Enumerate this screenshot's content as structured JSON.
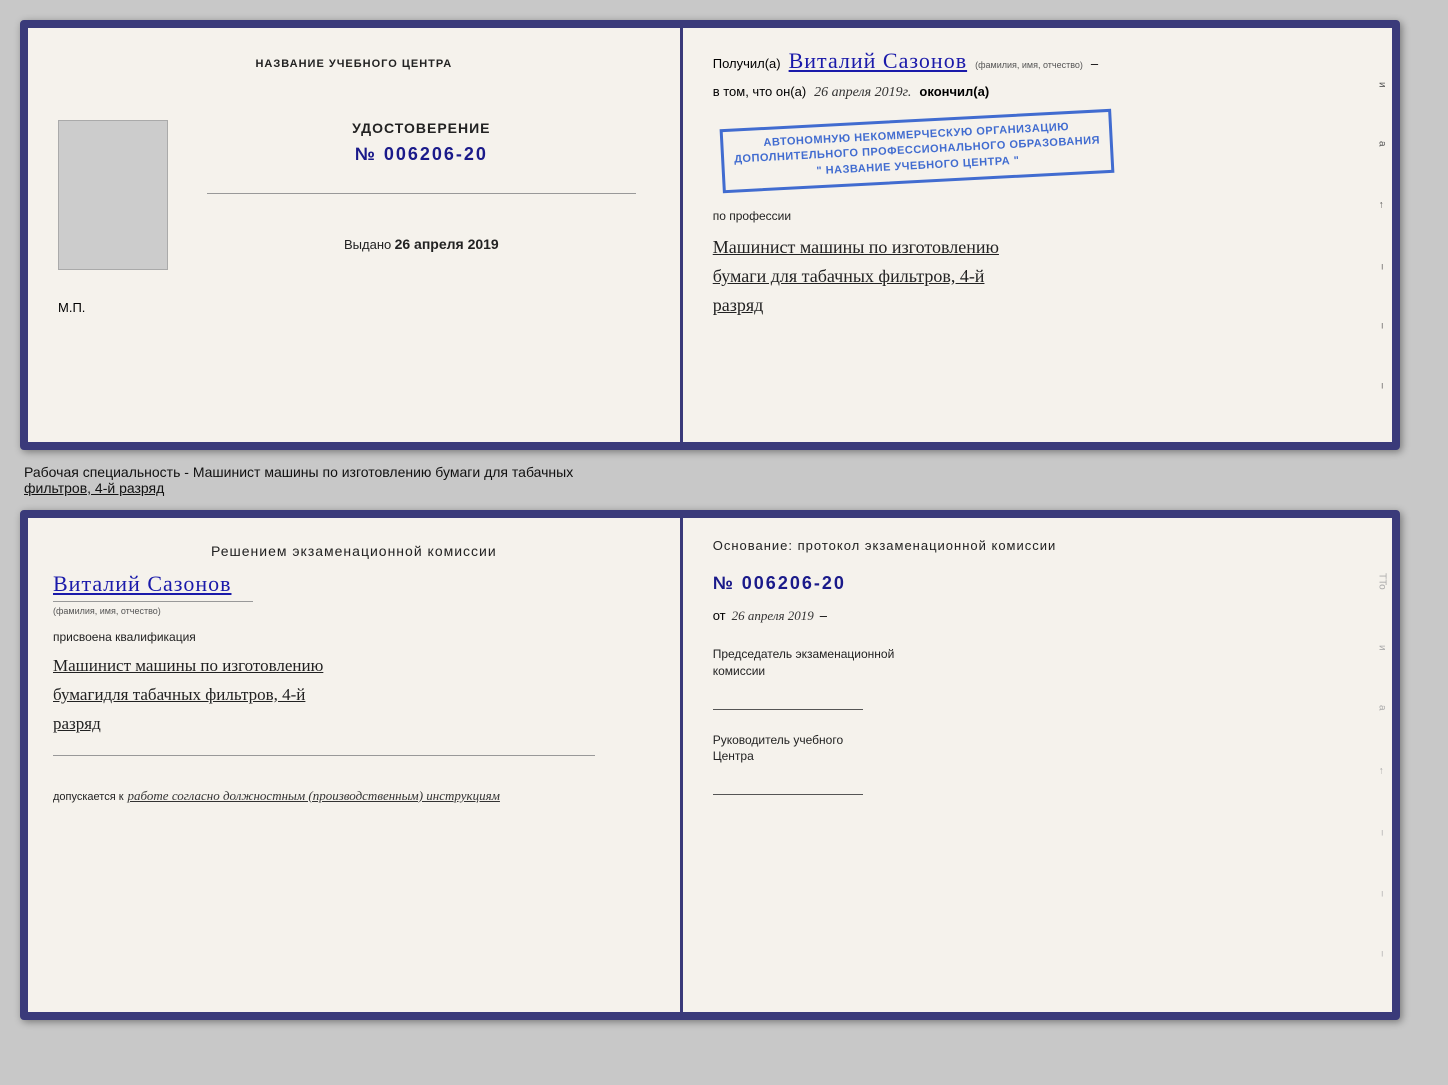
{
  "topDoc": {
    "leftPage": {
      "orgTitle": "НАЗВАНИЕ УЧЕБНОГО ЦЕНТРА",
      "certLabel": "УДОСТОВЕРЕНИЕ",
      "certNumber": "№ 006206-20",
      "issuedLabel": "Выдано",
      "issuedDate": "26 апреля 2019",
      "mpLabel": "М.П."
    },
    "rightPage": {
      "receivedLabel": "Получил(а)",
      "recipientName": "Виталий Сазонов",
      "recipientSubtitle": "(фамилия, имя, отчество)",
      "inThatLabel": "в том, что он(а)",
      "completedDate": "26 апреля 2019г.",
      "completedLabel": "окончил(а)",
      "stampLine1": "АВТОНОМНУЮ НЕКОММЕРЧЕСКУЮ ОРГАНИЗАЦИЮ",
      "stampLine2": "ДОПОЛНИТЕЛЬНОГО ПРОФЕССИОНАЛЬНОГО ОБРАЗОВАНИЯ",
      "stampLine3": "\" НАЗВАНИЕ УЧЕБНОГО ЦЕНТРА \"",
      "professionLabel": "по профессии",
      "professionLine1": "Машинист машины по изготовлению",
      "professionLine2": "бумаги для табачных фильтров, 4-й",
      "professionLine3": "разряд",
      "edgeMarks": [
        "и",
        "а",
        "←",
        "–",
        "–",
        "–"
      ]
    }
  },
  "betweenLabel": {
    "text1": "Рабочая специальность - Машинист машины по изготовлению бумаги для табачных",
    "text2": "фильтров, 4-й разряд"
  },
  "bottomDoc": {
    "leftPage": {
      "sectionTitle": "Решением  экзаменационной  комиссии",
      "personName": "Виталий Сазонов",
      "personSubtitle": "(фамилия, имя, отчество)",
      "qualificationLabel": "присвоена квалификация",
      "qualLine1": "Машинист машины по изготовлению",
      "qualLine2": "бумагидля табачных фильтров, 4-й",
      "qualLine3": "разряд",
      "admissionLabel": "допускается к",
      "admissionText": "работе согласно должностным (производственным) инструкциям"
    },
    "rightPage": {
      "basisTitle": "Основание: протокол экзаменационной  комиссии",
      "protocolNumber": "№  006206-20",
      "datePrefix": "от",
      "protocolDate": "26 апреля 2019",
      "chairLabel1": "Председатель экзаменационной",
      "chairLabel2": "комиссии",
      "headLabel1": "Руководитель учебного",
      "headLabel2": "Центра",
      "edgeMarks": [
        "и",
        "а",
        "←",
        "–",
        "–",
        "–"
      ]
    }
  }
}
